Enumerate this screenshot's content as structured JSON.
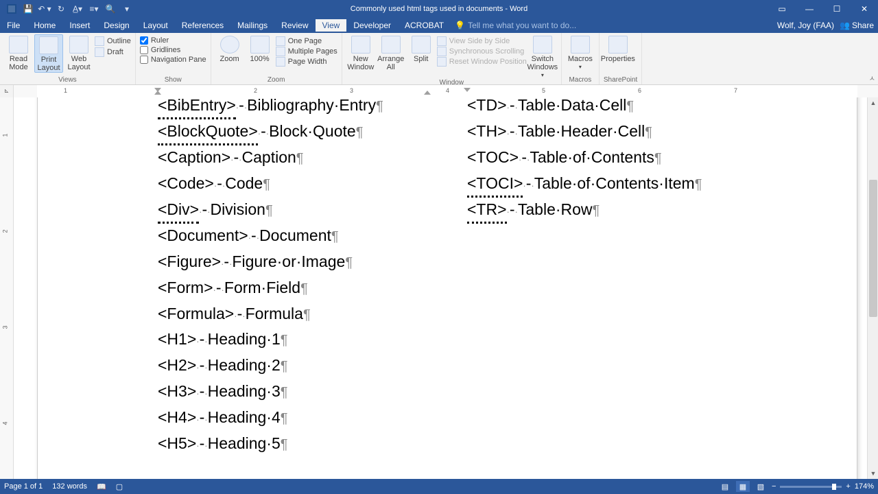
{
  "title": "Commonly used html tags used in documents - Word",
  "qat": [
    "save",
    "undo",
    "redo",
    "format",
    "spacing",
    "preview",
    "more"
  ],
  "tabs": [
    "File",
    "Home",
    "Insert",
    "Design",
    "Layout",
    "References",
    "Mailings",
    "Review",
    "View",
    "Developer",
    "ACROBAT"
  ],
  "active_tab": "View",
  "tellme": "Tell me what you want to do...",
  "user": "Wolf, Joy (FAA)",
  "share": "Share",
  "ribbon": {
    "views": {
      "name": "Views",
      "read": "Read\nMode",
      "print": "Print\nLayout",
      "web": "Web\nLayout",
      "outline": "Outline",
      "draft": "Draft"
    },
    "show": {
      "name": "Show",
      "ruler": "Ruler",
      "gridlines": "Gridlines",
      "nav": "Navigation Pane"
    },
    "zoom": {
      "name": "Zoom",
      "zoom": "Zoom",
      "p100": "100%",
      "one": "One Page",
      "multi": "Multiple Pages",
      "width": "Page Width"
    },
    "window": {
      "name": "Window",
      "new": "New\nWindow",
      "arrange": "Arrange\nAll",
      "split": "Split",
      "side": "View Side by Side",
      "sync": "Synchronous Scrolling",
      "reset": "Reset Window Position",
      "switch": "Switch\nWindows"
    },
    "macros": {
      "name": "Macros",
      "macros": "Macros"
    },
    "sharepoint": {
      "name": "SharePoint",
      "props": "Properties"
    }
  },
  "ruler_nums": [
    "1",
    "2",
    "3",
    "4",
    "5",
    "6",
    "7"
  ],
  "doc": {
    "col1": [
      {
        "tag": "<BibEntry>",
        "sq": true,
        "desc": "Bibliography·Entry"
      },
      {
        "tag": "<BlockQuote>",
        "sq": true,
        "desc": "Block·Quote"
      },
      {
        "tag": "<Caption>",
        "desc": "Caption"
      },
      {
        "tag": "<Code>",
        "desc": "Code"
      },
      {
        "tag": "<Div>",
        "sq": true,
        "desc": "Division"
      },
      {
        "tag": "<Document>",
        "desc": "Document"
      },
      {
        "tag": "<Figure>",
        "desc": "Figure·or·Image"
      },
      {
        "tag": "<Form>",
        "desc": "Form·Field"
      },
      {
        "tag": "<Formula>",
        "desc": "Formula"
      },
      {
        "tag": "<H1>",
        "desc": "Heading·1"
      },
      {
        "tag": "<H2>",
        "desc": "Heading·2"
      },
      {
        "tag": "<H3>",
        "desc": "Heading·3"
      },
      {
        "tag": "<H4>",
        "desc": "Heading·4"
      },
      {
        "tag": "<H5>",
        "desc": "Heading·5"
      }
    ],
    "col2": [
      {
        "tag": "<TD>",
        "desc": "Table·Data·Cell"
      },
      {
        "tag": "<TH>",
        "desc": "Table·Header·Cell"
      },
      {
        "tag": "<TOC>",
        "desc": "Table·of·Contents"
      },
      {
        "tag": "<TOCI>",
        "sq": true,
        "desc": "Table·of·Contents·Item"
      },
      {
        "tag": "<TR>",
        "sq": true,
        "desc": "Table·Row"
      }
    ]
  },
  "status": {
    "page": "Page 1 of 1",
    "words": "132 words",
    "zoom": "174%"
  }
}
